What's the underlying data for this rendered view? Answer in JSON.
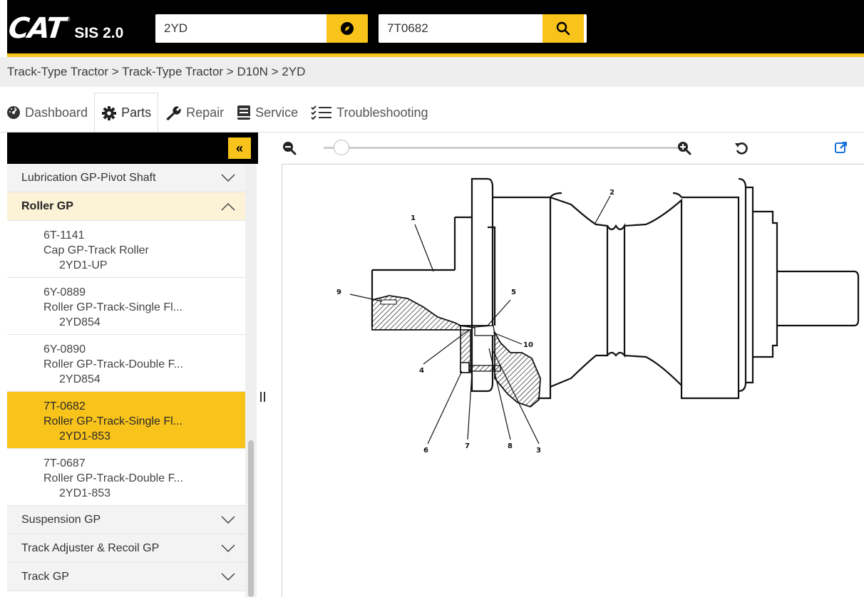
{
  "header": {
    "logo_text": "CAT",
    "logo_reg": "®",
    "app_name": "SIS 2.0",
    "serial_search": {
      "value": "2YD"
    },
    "part_search": {
      "value": "7T0682"
    },
    "accent_color": "#f8c31b"
  },
  "breadcrumb": {
    "text": "Track-Type Tractor > Track-Type Tractor > D10N > 2YD"
  },
  "tabs": [
    {
      "label": "Dashboard",
      "icon": "dashboard-icon"
    },
    {
      "label": "Parts",
      "icon": "gear-icon",
      "active": true
    },
    {
      "label": "Repair",
      "icon": "wrench-icon"
    },
    {
      "label": "Service",
      "icon": "book-icon"
    },
    {
      "label": "Troubleshooting",
      "icon": "checklist-icon"
    }
  ],
  "sidebar": {
    "collapse_label": "«",
    "groups_top": [
      {
        "label": "Lubrication GP-Pivot Shaft"
      }
    ],
    "open_group": {
      "label": "Roller GP"
    },
    "items": [
      {
        "part": "6T-1141",
        "name": "Cap GP-Track Roller",
        "serial": "2YD1-UP"
      },
      {
        "part": "6Y-0889",
        "name": "Roller GP-Track-Single Fl...",
        "serial": "2YD854"
      },
      {
        "part": "6Y-0890",
        "name": "Roller GP-Track-Double F...",
        "serial": "2YD854"
      },
      {
        "part": "7T-0682",
        "name": "Roller GP-Track-Single Fl...",
        "serial": "2YD1-853",
        "selected": true
      },
      {
        "part": "7T-0687",
        "name": "Roller GP-Track-Double F...",
        "serial": "2YD1-853"
      }
    ],
    "groups_bottom": [
      {
        "label": "Suspension GP"
      },
      {
        "label": "Track Adjuster & Recoil GP"
      },
      {
        "label": "Track GP"
      }
    ]
  },
  "viewer": {
    "zoom": 0.05,
    "callouts": [
      "1",
      "2",
      "3",
      "4",
      "5",
      "6",
      "7",
      "8",
      "9",
      "10"
    ]
  }
}
